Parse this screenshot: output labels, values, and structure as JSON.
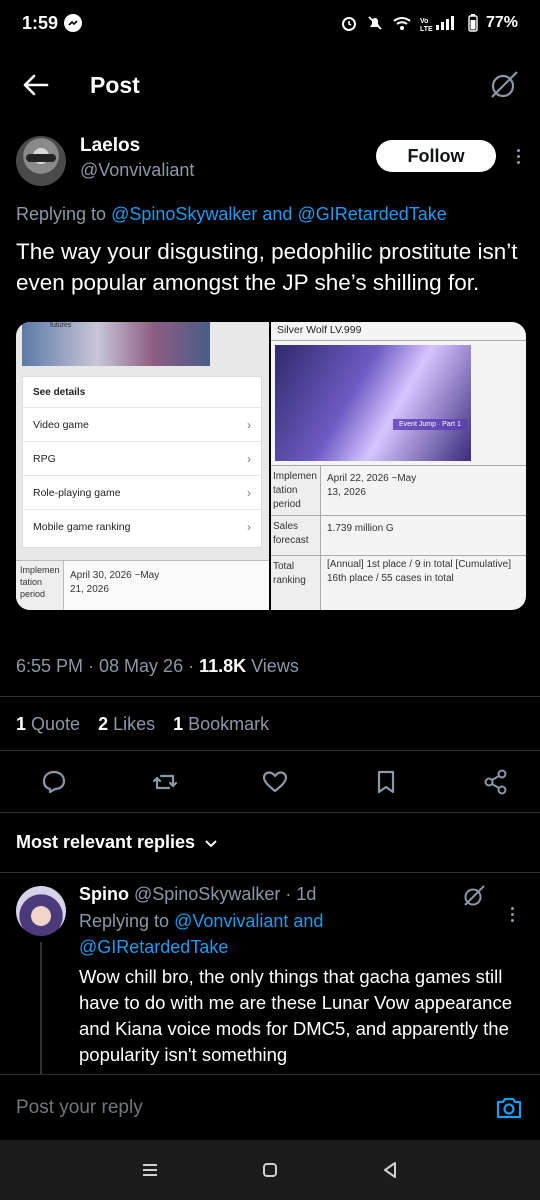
{
  "status_bar": {
    "time": "1:59",
    "battery": "77%"
  },
  "header": {
    "title": "Post"
  },
  "tweet": {
    "author_name": "Laelos",
    "author_handle": "@Vonvivaliant",
    "follow_label": "Follow",
    "replying_prefix": "Replying to ",
    "replying_user1": "@SpinoSkywalker",
    "replying_and": " and ",
    "replying_user2": "@GIRetardedTake",
    "text": "The way your disgusting, pedophilic prostitute isn’t even popular amongst the JP she’s shilling for.",
    "time": "6:55 PM · 08 May 26 · ",
    "views_count": "11.8K",
    "views_label": " Views",
    "stats": [
      {
        "count": "1",
        "label": " Quote"
      },
      {
        "count": "2",
        "label": " Likes"
      },
      {
        "count": "1",
        "label": " Bookmark"
      }
    ],
    "media_left": {
      "banner_label": "futures",
      "see_details": "See details",
      "items": [
        "Video game",
        "RPG",
        "Role-playing game",
        "Mobile game ranking"
      ],
      "table_header": "Implemen tation period",
      "table_value": "April 30, 2026 ~May 21, 2026"
    },
    "media_right": {
      "title": "Silver Wolf LV.999",
      "image_label": "Event Jump · Part 1",
      "rows": [
        {
          "header": "Implemen tation period",
          "value": "April 22, 2026 ~May 13, 2026"
        },
        {
          "header": "Sales forecast",
          "value": "1.739 million G"
        },
        {
          "header": "Total ranking",
          "value": "[Annual] 1st place / 9 in total [Cumulative] 16th place / 55 cases in total"
        }
      ]
    }
  },
  "replies_section": {
    "label": "Most relevant replies"
  },
  "reply": {
    "name": "Spino",
    "handle_time": " @SpinoSkywalker · 1d",
    "replying_prefix": "Replying to ",
    "replying_user1": "@Vonvivaliant and",
    "replying_user2": "@GIRetardedTake",
    "text": "Wow chill bro, the only things that gacha games still have to do with me are these Lunar Vow appearance and Kiana voice mods for DMC5, and apparently the popularity isn't something"
  },
  "compose": {
    "placeholder": "Post your reply"
  },
  "colors": {
    "accent": "#1d9bf0",
    "background": "#000000",
    "muted": "#8b98a5"
  }
}
